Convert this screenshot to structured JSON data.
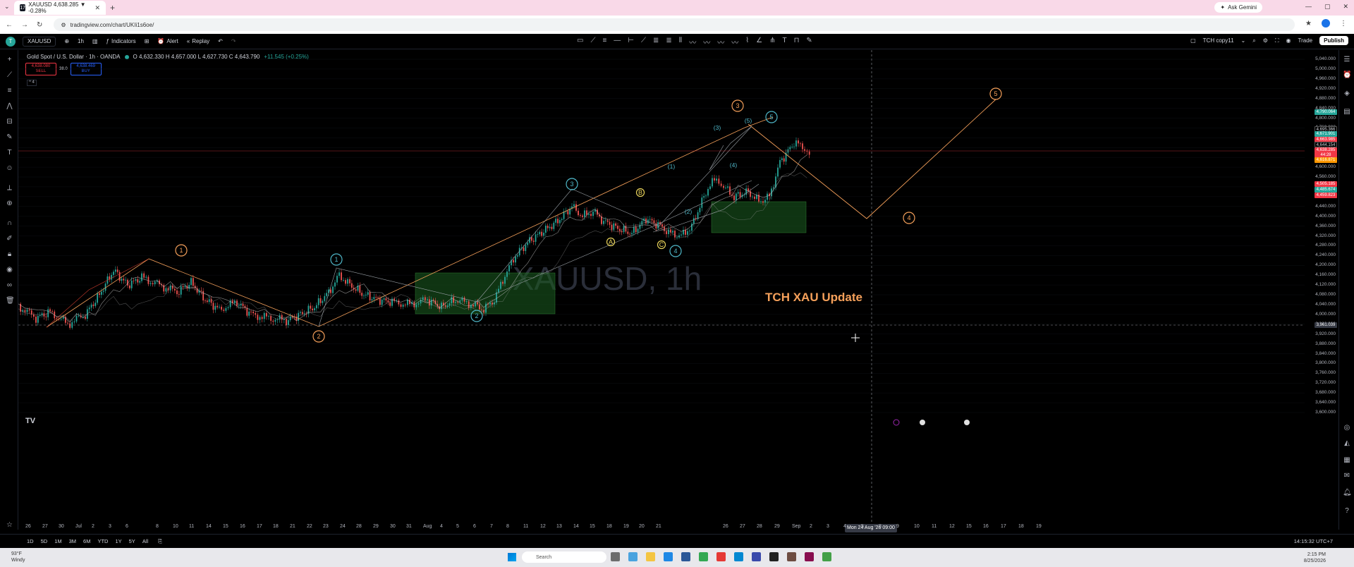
{
  "browser": {
    "tab_title": "XAUUSD 4,638.285 ▼ -0.28%",
    "new_tab": "+",
    "gemini_label": "Ask Gemini",
    "url": "tradingview.com/chart/UKIi1s6oe/",
    "window_controls": [
      "—",
      "▢",
      "✕"
    ]
  },
  "toolbar": {
    "symbol": "XAUUSD",
    "interval": "1h",
    "indicators_label": "Indicators",
    "alert_label": "Alert",
    "replay_label": "Replay",
    "layout_name": "TCH copy11",
    "trade_label": "Trade",
    "publish_label": "Publish"
  },
  "legend": {
    "instrument": "Gold Spot / U.S. Dollar · 1h · OANDA",
    "ohlc": "O 4,632.330  H 4,657.000  L 4,627.730  C 4,643.790",
    "change": "+11.545 (+0.25%)",
    "sell_price": "4,638.080",
    "sell_label": "SELL",
    "spread": "38.0",
    "buy_price": "4,638.469",
    "buy_label": "BUY",
    "collapse_label": "^ 4"
  },
  "chart": {
    "watermark": "XAUUSD, 1h",
    "annotation_text": "TCH XAU Update",
    "colors": {
      "orange": "#f5a05a",
      "teal": "#4fb8c9",
      "yellow": "#e8d25a",
      "box_green": "#2e7d32",
      "up": "#26a69a",
      "down": "#ef5350"
    },
    "wave_labels": {
      "orange_1": "1",
      "orange_2": "2",
      "orange_3": "3",
      "orange_4": "4",
      "orange_5": "5",
      "teal_1": "1",
      "teal_2": "2",
      "teal_3": "3",
      "teal_4": "4",
      "teal_5": "5",
      "abc_a": "A",
      "abc_b": "B",
      "abc_c": "C",
      "sub_1": "(1)",
      "sub_2": "(2)",
      "sub_3": "(3)",
      "sub_4": "(4)",
      "sub_5": "(5)"
    }
  },
  "price_axis": {
    "ticks": [
      "5,040.000",
      "5,000.000",
      "4,960.000",
      "4,920.000",
      "4,880.000",
      "4,840.000",
      "4,800.000",
      "4,760.000",
      "4,720.000",
      "4,680.000",
      "4,640.000",
      "4,600.000",
      "4,560.000",
      "4,520.000",
      "4,480.000",
      "4,440.000",
      "4,400.000",
      "4,360.000",
      "4,320.000",
      "4,280.000",
      "4,240.000",
      "4,200.000",
      "4,160.000",
      "4,120.000",
      "4,080.000",
      "4,040.000",
      "4,000.000",
      "3,960.000",
      "3,920.000",
      "3,880.000",
      "3,840.000",
      "3,800.000",
      "3,760.000",
      "3,720.000",
      "3,680.000",
      "3,640.000",
      "3,600.000"
    ],
    "badges": [
      {
        "text": "4,790.064",
        "color": "#26a69a"
      },
      {
        "text": "4,695.366",
        "color": "#000000"
      },
      {
        "text": "4,671.901",
        "color": "#26a69a"
      },
      {
        "text": "4,663.985",
        "color": "#f23645"
      },
      {
        "text": "4,644.154",
        "color": "#000000"
      },
      {
        "text": "4,638.285",
        "color": "#f23645"
      },
      {
        "text": "44:28",
        "color": "#f23645"
      },
      {
        "text": "4,616.871",
        "color": "#ff9800"
      },
      {
        "text": "4,505.185",
        "color": "#f23645"
      },
      {
        "text": "4,485.674",
        "color": "#26a69a"
      },
      {
        "text": "4,459.823",
        "color": "#f23645"
      },
      {
        "text": "3,961.039",
        "color": "#363a45"
      }
    ]
  },
  "time_axis": {
    "labels": [
      "26",
      "27",
      "30",
      "Jul",
      "2",
      "3",
      "6",
      "8",
      "10",
      "11",
      "14",
      "15",
      "16",
      "17",
      "18",
      "21",
      "22",
      "23",
      "24",
      "28",
      "29",
      "30",
      "31",
      "Aug",
      "4",
      "5",
      "6",
      "7",
      "8",
      "11",
      "12",
      "13",
      "14",
      "15",
      "18",
      "19",
      "20",
      "21",
      "26",
      "27",
      "28",
      "29",
      "Sep",
      "2",
      "3",
      "4",
      "5",
      "8",
      "9",
      "10",
      "11",
      "12",
      "15",
      "16",
      "17",
      "18",
      "19"
    ],
    "crosshair": "Mon 24 Aug '26  09:00"
  },
  "bottom": {
    "ranges": [
      "1D",
      "5D",
      "1M",
      "3M",
      "6M",
      "YTD",
      "1Y",
      "5Y",
      "All"
    ],
    "clock": "14:15:32 UTC+7"
  },
  "taskbar": {
    "temp": "93°F",
    "weather": "Windy",
    "search": "Search",
    "time": "2:15 PM",
    "date": "8/25/2026"
  }
}
